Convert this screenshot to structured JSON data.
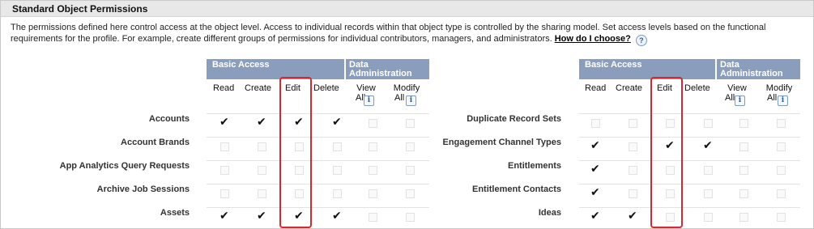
{
  "section": {
    "title": "Standard Object Permissions"
  },
  "description": {
    "text": "The permissions defined here control access at the object level. Access to individual records within that object type is controlled by the sharing model. Set access levels based on the functional requirements for the profile. For example, create different groups of permissions for individual contributors, managers, and administrators.",
    "link_label": "How do I choose?",
    "help_icon": "?"
  },
  "groups": {
    "basic_access": "Basic Access",
    "data_admin_line1": "Data",
    "data_admin_line2": "Administration"
  },
  "columns": {
    "read": "Read",
    "create": "Create",
    "edit": "Edit",
    "delete": "Delete",
    "view_all_1": "View",
    "view_all_2": "All",
    "modify_all_1": "Modify",
    "modify_all_2": "All",
    "info_icon": "i"
  },
  "left_table": {
    "rows": [
      {
        "label": "Accounts",
        "perms": [
          true,
          true,
          true,
          true,
          false,
          false
        ]
      },
      {
        "label": "Account Brands",
        "perms": [
          false,
          false,
          false,
          false,
          false,
          false
        ]
      },
      {
        "label": "App Analytics Query Requests",
        "perms": [
          false,
          false,
          false,
          false,
          false,
          false
        ]
      },
      {
        "label": "Archive Job Sessions",
        "perms": [
          false,
          false,
          false,
          false,
          false,
          false
        ]
      },
      {
        "label": "Assets",
        "perms": [
          true,
          true,
          true,
          true,
          false,
          false
        ]
      }
    ]
  },
  "right_table": {
    "rows": [
      {
        "label": "Duplicate Record Sets",
        "perms": [
          false,
          false,
          false,
          false,
          false,
          false
        ]
      },
      {
        "label": "Engagement Channel Types",
        "perms": [
          true,
          false,
          true,
          true,
          false,
          false
        ]
      },
      {
        "label": "Entitlements",
        "perms": [
          true,
          false,
          false,
          false,
          false,
          false
        ]
      },
      {
        "label": "Entitlement Contacts",
        "perms": [
          true,
          false,
          false,
          false,
          false,
          false
        ]
      },
      {
        "label": "Ideas",
        "perms": [
          true,
          true,
          false,
          false,
          false,
          false
        ]
      }
    ]
  },
  "colors": {
    "group_header_bg": "#8b9dbd",
    "highlight": "#d7282f",
    "section_header_bg": "#e8e8e8"
  }
}
